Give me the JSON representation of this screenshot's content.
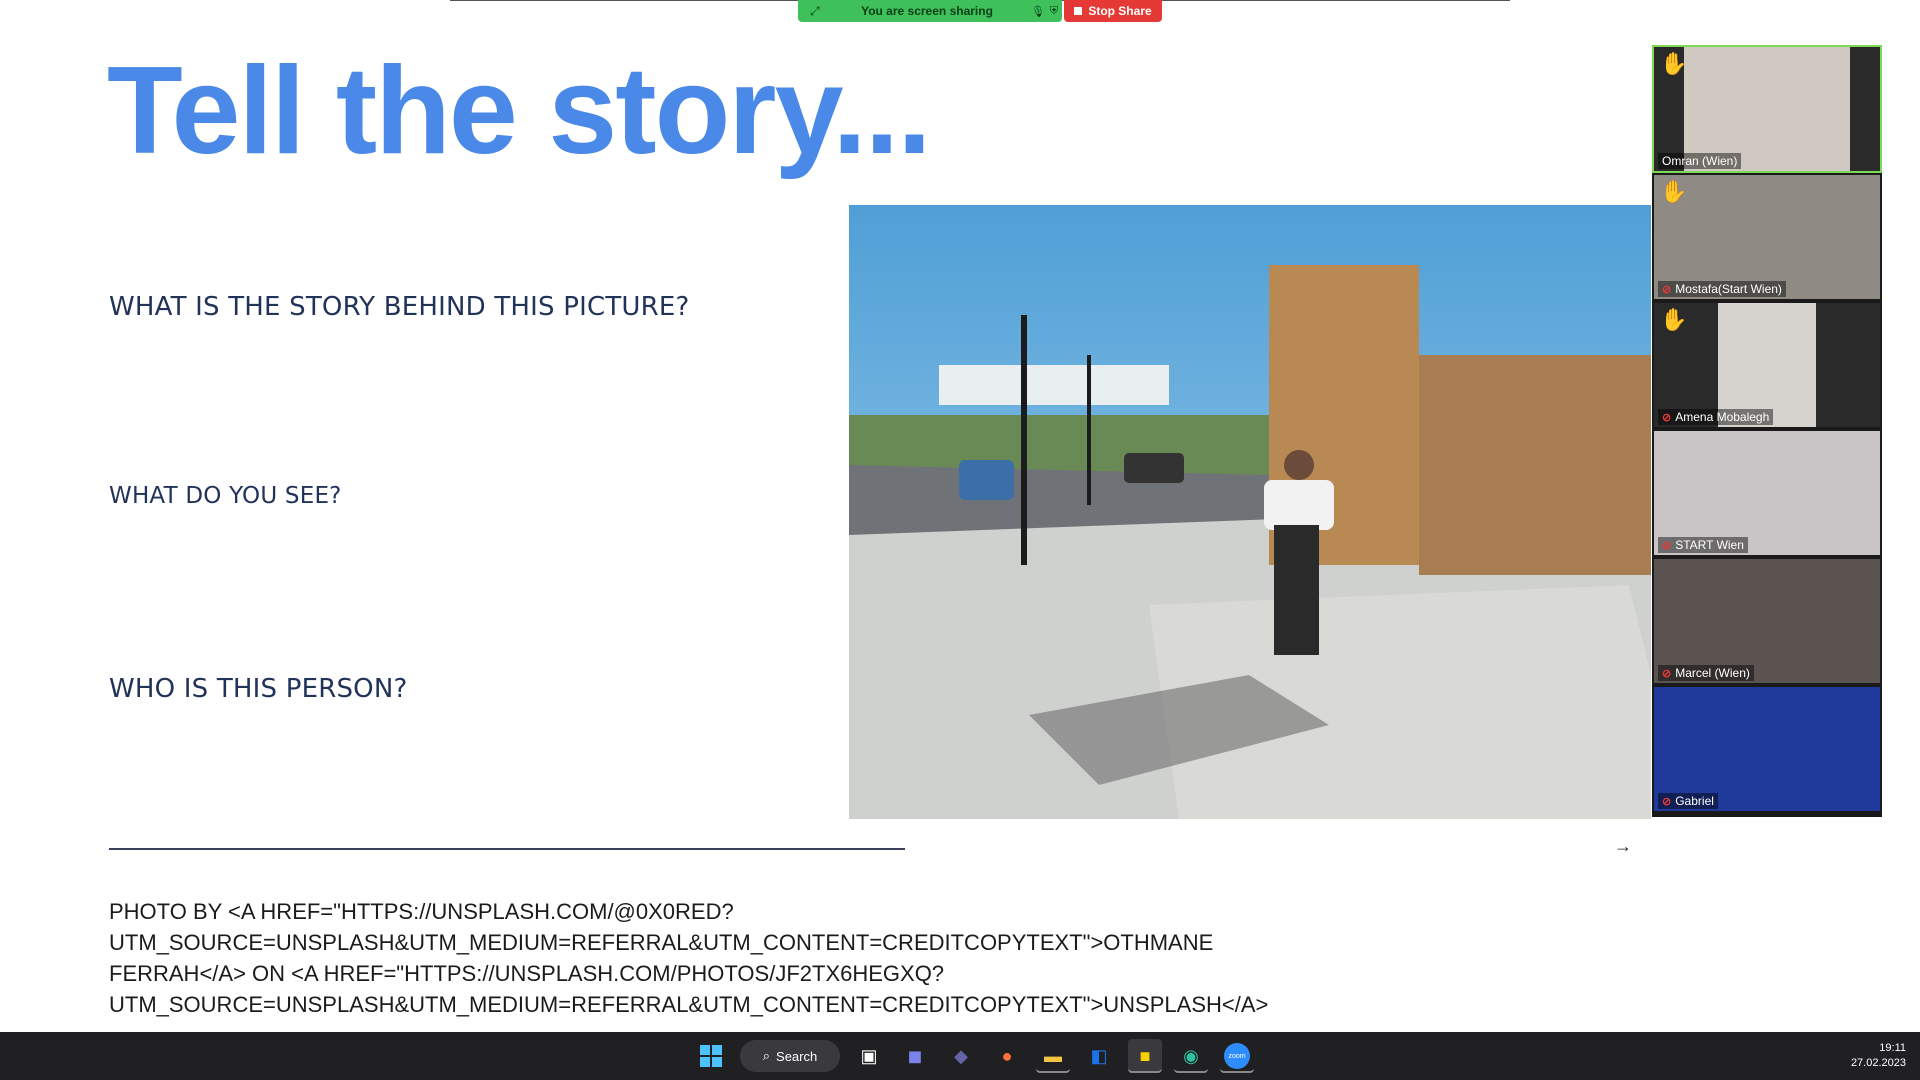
{
  "zoom_share": {
    "banner_text": "You are screen sharing",
    "stop_label": "Stop Share"
  },
  "slide": {
    "title": "Tell the story...",
    "questions": [
      "WHAT IS THE STORY BEHIND THIS PICTURE?",
      "WHAT DO YOU SEE?",
      "WHO IS THIS PERSON?"
    ],
    "credit_lines": [
      "PHOTO BY <A HREF=\"HTTPS://UNSPLASH.COM/@0X0RED?",
      "UTM_SOURCE=UNSPLASH&UTM_MEDIUM=REFERRAL&UTM_CONTENT=CREDITCOPYTEXT\">OTHMANE",
      "FERRAH</A> ON <A HREF=\"HTTPS://UNSPLASH.COM/PHOTOS/JF2TX6HEGXQ?",
      "UTM_SOURCE=UNSPLASH&UTM_MEDIUM=REFERRAL&UTM_CONTENT=CREDITCOPYTEXT\">UNSPLASH</A>"
    ]
  },
  "participants": [
    {
      "name": "Omran (Wien)",
      "hand_raised": true,
      "muted": false,
      "speaking": true
    },
    {
      "name": "Mostafa(Start Wien)",
      "hand_raised": true,
      "muted": true,
      "speaking": false
    },
    {
      "name": "Amena Mobalegh",
      "hand_raised": true,
      "muted": true,
      "speaking": false
    },
    {
      "name": "START Wien",
      "hand_raised": false,
      "muted": true,
      "speaking": false
    },
    {
      "name": "Marcel (Wien)",
      "hand_raised": false,
      "muted": true,
      "speaking": false
    },
    {
      "name": "Gabriel",
      "hand_raised": false,
      "muted": true,
      "speaking": false
    }
  ],
  "taskbar": {
    "search_label": "Search",
    "time": "19:11",
    "date": "27.02.2023",
    "zoom_label": "zoom"
  },
  "colors": {
    "title_blue": "#4a89e8",
    "share_green": "#3ec05a",
    "stop_red": "#e53935",
    "active_speaker_border": "#7ed957"
  }
}
